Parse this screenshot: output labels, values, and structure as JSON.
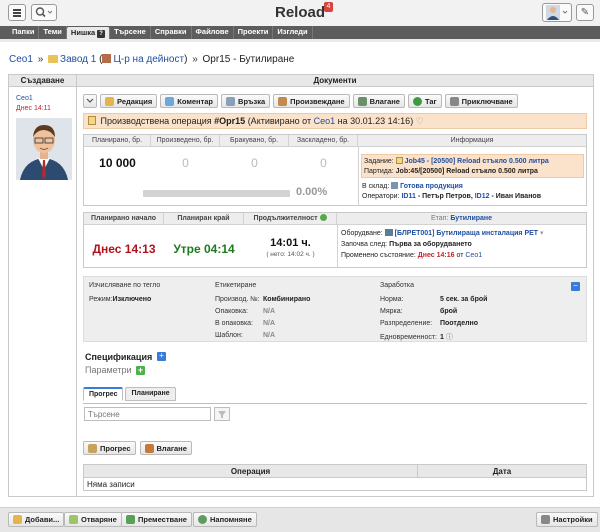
{
  "header": {
    "app_title": "Reload",
    "notifications": "4"
  },
  "nav": {
    "tabs": [
      "Папки",
      "Теми",
      "Нишка",
      "Търсене",
      "Справки",
      "Файлове",
      "Проекти",
      "Изгледи"
    ],
    "active_help": "?"
  },
  "breadcrumb": {
    "root": "Ceo1",
    "sep1": "»",
    "folder": "Завод 1",
    "paren_open": "(",
    "center": "Ц-р на дейност",
    "paren_close": ")",
    "sep2": "»",
    "current": "Opr15 - Бутилиране"
  },
  "columns": {
    "creation": "Създаване",
    "documents": "Документи"
  },
  "creator": {
    "name": "Ceo1",
    "time": "Днес 14:11"
  },
  "toolbar": {
    "edit": "Редакция",
    "comment": "Коментар",
    "link": "Връзка",
    "produce": "Произвеждане",
    "input": "Влагане",
    "tag": "Таг",
    "finish": "Приключване"
  },
  "operation": {
    "prefix": "Производствена операция",
    "code": "#Opr15",
    "activated": "(Активирано от",
    "by": "Ceo1",
    "on": "на 30.01.23 14:16)"
  },
  "quantities": {
    "headers": [
      "Планирано, бр.",
      "Произведено, бр.",
      "Бракувано, бр.",
      "Заскладено, бр."
    ],
    "values": [
      "10 000",
      "0",
      "0",
      "0"
    ],
    "progress": 0.0,
    "progress_label": "0.00%"
  },
  "info": {
    "title": "Информация",
    "task_label": "Задание:",
    "task_value": "Job45 - [20500] Reload стъкло 0.500 литра",
    "batch_label": "Партида:",
    "batch_value": "Job:45/[20500] Reload стъкло 0.500 литра",
    "store_label": "В склад:",
    "store_value": "Готова продукция",
    "operators_label": "Оператори:",
    "op1_id": "ID11",
    "op1_name": "- Петър Петров,",
    "op2_id": "ID12",
    "op2_name": "- Иван Иванов"
  },
  "timing": {
    "headers": [
      "Планирано начало",
      "Планиран край",
      "Продължителност"
    ],
    "start": "Днес 14:13",
    "end": "Утре 04:14",
    "duration": "14:01 ч.",
    "net": "( нето: 14:02 ч. )",
    "stage_label": "Етап:",
    "stage_value": "Бутилиране",
    "equipment_label": "Оборудване:",
    "equipment_value": "[БЛРЕТ001] Бутилираща инсталация PET",
    "starts_after_label": "Започва след:",
    "starts_after_value": "Първа за оборудването",
    "changed_label": "Променено състояние:",
    "changed_time": "Днес 14:16",
    "changed_from": "от",
    "changed_by": "Ceo1"
  },
  "params": {
    "weight_head": "Изчисляване по тегло",
    "mode_label": "Режим:",
    "mode_value": "Изключено",
    "labeling_head": "Етикетиране",
    "prod_no_label": "Производ. №:",
    "prod_no_value": "Комбинирано",
    "pack_label": "Опаковка:",
    "pack_value": "N/A",
    "in_pack_label": "В опаковка:",
    "in_pack_value": "N/A",
    "template_label": "Шаблон:",
    "template_value": "N/A",
    "wage_head": "Заработка",
    "norm_label": "Норма:",
    "norm_value": "5 сек. за брой",
    "measure_label": "Мярка:",
    "measure_value": "брой",
    "distribution_label": "Разпределение:",
    "distribution_value": "Поотделно",
    "simultaneity_label": "Едновременност:",
    "simultaneity_value": "1"
  },
  "spec": {
    "title": "Спецификация",
    "params_title": "Параметри"
  },
  "tabs": [
    "Прогрес",
    "Планиране"
  ],
  "search": {
    "placeholder": "Търсене"
  },
  "actions": {
    "progress": "Прогрес",
    "input": "Влагане"
  },
  "ops_table": {
    "headers": [
      "Операция",
      "Дата"
    ],
    "empty": "Няма записи"
  },
  "footer": {
    "add": "Добави...",
    "open": "Отваряне",
    "move": "Преместване",
    "remind": "Напомняне",
    "settings": "Настройки"
  }
}
